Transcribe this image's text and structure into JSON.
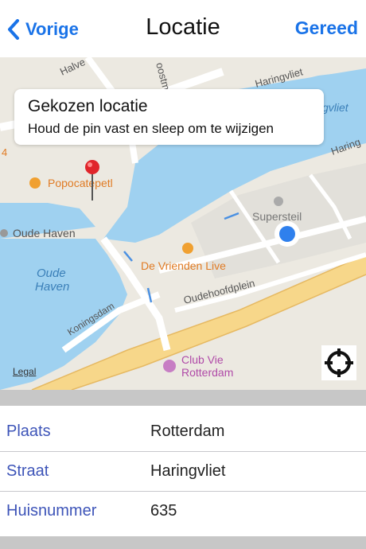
{
  "nav": {
    "back_label": "Vorige",
    "title": "Locatie",
    "done_label": "Gereed"
  },
  "callout": {
    "title": "Gekozen locatie",
    "subtitle": "Houd de pin vast en sleep om te wijzigen"
  },
  "map": {
    "labels": {
      "halve": "Halve",
      "oostmol": "oostmol",
      "haringvliet_top": "Haringvliet",
      "haringvliet_water": "gvliet",
      "haringvliet_right": "Haring",
      "popocatepetl": "Popocatepetl",
      "oude_haven_poi": "Oude Haven",
      "oude_haven_water_1": "Oude",
      "oude_haven_water_2": "Haven",
      "supersteil": "Supersteil",
      "de_vrienden_live": "De Vrienden Live",
      "oudehoofdplein": "Oudehoofdplein",
      "koningsdam": "Koningsdam",
      "club_vie_1": "Club Vie",
      "club_vie_2": "Rotterdam",
      "edge_number": "4"
    },
    "legal": "Legal"
  },
  "form": {
    "rows": [
      {
        "label": "Plaats",
        "value": "Rotterdam"
      },
      {
        "label": "Straat",
        "value": "Haringvliet"
      },
      {
        "label": "Huisnummer",
        "value": "635"
      }
    ]
  },
  "colors": {
    "accent": "#1a73e8",
    "label": "#3d54b8",
    "water": "#9fd1f0",
    "land": "#ece9e1",
    "road_major": "#f7d78a",
    "pin": "#e0252b",
    "user_location": "#2f80ed"
  },
  "icons": {
    "back": "chevron-left-icon",
    "locate": "crosshair-icon",
    "pin": "map-pin-icon",
    "food": "fork-knife-icon",
    "cocktail": "cocktail-icon",
    "poi": "poi-dot-icon"
  }
}
